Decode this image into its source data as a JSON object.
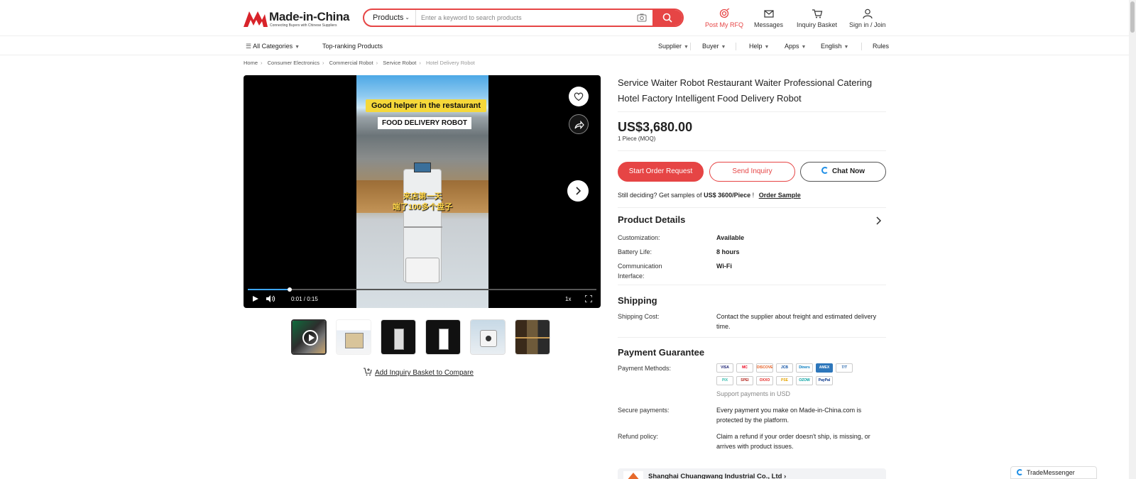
{
  "header": {
    "logo_text": "Made-in-China",
    "logo_tagline": "Connecting Buyers with Chinese Suppliers",
    "search_category": "Products",
    "search_placeholder": "Enter a keyword to search products",
    "nav": [
      {
        "label": "Post My RFQ",
        "icon": "rfq-icon",
        "color": "#e64545"
      },
      {
        "label": "Messages",
        "icon": "mail-icon"
      },
      {
        "label": "Inquiry Basket",
        "icon": "cart-icon"
      },
      {
        "label": "Sign in / Join",
        "icon": "user-icon"
      }
    ]
  },
  "subnav": {
    "all_categories": "All Categories",
    "top_ranking": "Top-ranking Products",
    "supplier": "Supplier",
    "buyer": "Buyer",
    "help": "Help",
    "apps": "Apps",
    "language": "English",
    "rules": "Rules"
  },
  "breadcrumb": [
    "Home",
    "Consumer Electronics",
    "Commercial Robot",
    "Service Robot",
    "Hotel Delivery Robot"
  ],
  "video": {
    "caption1": "Good helper in the restaurant",
    "caption2": "FOOD DELIVERY ROBOT",
    "caption3_line1": "来店第一天",
    "caption3_line2": "端了100多个盘子",
    "time": "0:01 / 0:15",
    "speed": "1x",
    "progress": 0.12
  },
  "compare_label": "Add Inquiry Basket to Compare",
  "product": {
    "title": "Service Waiter Robot Restaurant Waiter Professional Catering Hotel Factory Intelligent Food Delivery Robot",
    "price": "US$3,680.00",
    "moq": "1 Piece (MOQ)",
    "btn_order": "Start Order Request",
    "btn_inquiry": "Send Inquiry",
    "btn_chat": "Chat Now",
    "sample_prefix": "Still deciding? Get samples of",
    "sample_price": "US$ 3600/Piece",
    "sample_suffix": "!",
    "sample_link": "Order Sample"
  },
  "details": {
    "title": "Product Details",
    "rows": [
      {
        "label": "Customization:",
        "value": "Available"
      },
      {
        "label": "Battery Life:",
        "value": "8 hours"
      },
      {
        "label": "Communication Interface:",
        "value": "Wi-Fi"
      }
    ]
  },
  "shipping": {
    "title": "Shipping",
    "label": "Shipping Cost:",
    "value": "Contact the supplier about freight and estimated delivery time."
  },
  "payment": {
    "title": "Payment Guarantee",
    "methods_label": "Payment Methods:",
    "methods_row1": [
      "VISA",
      "MC",
      "DISCOVER",
      "JCB",
      "Diners",
      "AMEX",
      "T/T"
    ],
    "methods_row2": [
      "PIX",
      "SPEI",
      "OXXO",
      "PSE",
      "OZOW",
      "PayPal"
    ],
    "usd_note": "Support payments in USD",
    "secure_label": "Secure payments:",
    "secure_value": "Every payment you make on Made-in-China.com is protected by the platform.",
    "refund_label": "Refund policy:",
    "refund_value": "Claim a refund if your order doesn't ship, is missing, or arrives with product issues."
  },
  "supplier_name": "Shanghai Chuangwang Industrial Co., Ltd",
  "trade_messenger": "TradeMessenger",
  "colors": {
    "accent": "#e64545",
    "chat_blue": "#1d8ee6"
  }
}
